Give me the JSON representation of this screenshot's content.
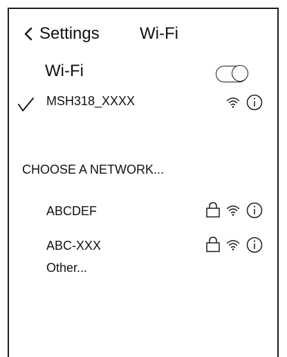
{
  "nav": {
    "back_label": "Settings",
    "title": "Wi-Fi"
  },
  "wifi_toggle": {
    "label": "Wi-Fi",
    "state": "off"
  },
  "connected_network": {
    "name": "MSH318_XXXX",
    "icons": [
      "checkmark-icon",
      "wifi-signal-icon",
      "info-icon"
    ]
  },
  "networks_section": {
    "header": "CHOOSE A NETWORK...",
    "networks": [
      {
        "name": "ABCDEF",
        "locked": true,
        "icons": [
          "lock-icon",
          "wifi-signal-icon",
          "info-icon"
        ]
      },
      {
        "name": "ABC-XXX",
        "locked": true,
        "icons": [
          "lock-icon",
          "wifi-signal-icon",
          "info-icon"
        ]
      }
    ],
    "other_label": "Other..."
  },
  "colors": {
    "stroke": "#1a1a1a",
    "background": "#ffffff"
  }
}
